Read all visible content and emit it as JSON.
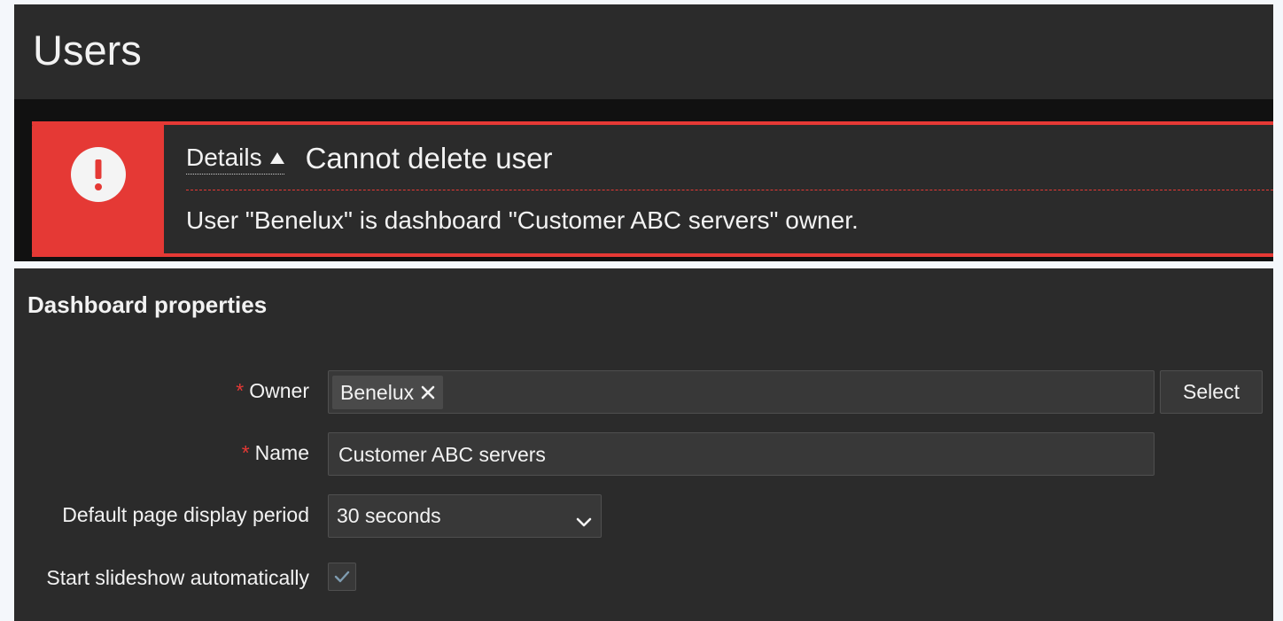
{
  "header": {
    "title": "Users"
  },
  "error": {
    "details_label": "Details",
    "title": "Cannot delete user",
    "message": "User \"Benelux\" is dashboard \"Customer ABC servers\" owner.",
    "icon": "exclamation-icon",
    "accent_color": "#e53935"
  },
  "dashboard_properties": {
    "title": "Dashboard properties",
    "required_marker": "*",
    "owner": {
      "label": "Owner",
      "tag": "Benelux",
      "select_button": "Select"
    },
    "name": {
      "label": "Name",
      "value": "Customer ABC servers"
    },
    "display_period": {
      "label": "Default page display period",
      "value": "30 seconds"
    },
    "slideshow": {
      "label": "Start slideshow automatically",
      "checked": true
    }
  }
}
